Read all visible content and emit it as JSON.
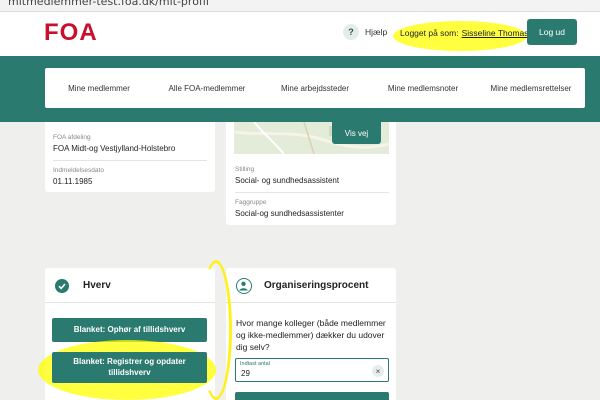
{
  "browser": {
    "url_fragment": "mitmedlemmer-test.foa.dk/mit-profil"
  },
  "header": {
    "logo_text": "FOA",
    "help_label": "Hjælp",
    "logged_in_prefix": "Logget på som:",
    "logged_in_user": "Sisseline Thomassen",
    "logout_label": "Log ud"
  },
  "nav": {
    "items": [
      "Mine medlemmer",
      "Alle FOA-medlemmer",
      "Mine arbejdssteder",
      "Mine medlemsnoter",
      "Mine medlemsrettelser"
    ]
  },
  "member_info": {
    "department_label": "FOA afdeling",
    "department_value": "FOA Midt-og Vestjylland-Holstebro",
    "enrollment_label": "Indmeldelsesdato",
    "enrollment_value": "01.11.1985"
  },
  "workplace": {
    "map_button": "Vis vej",
    "position_label": "Stilling",
    "position_value": "Social- og sundhedsassistent",
    "professional_group_label": "Faggruppe",
    "professional_group_value": "Social-og sundhedsassistenter"
  },
  "hverv": {
    "title": "Hverv",
    "button_resign": "Blanket: Ophør af tillidshverv",
    "button_register": "Blanket: Registrer og opdater tillidshverv"
  },
  "organisation": {
    "title": "Organiseringsprocent",
    "question": "Hvor mange kolleger (både medlemmer og ikke-medlemmer) dækker du udover dig selv?",
    "input_label": "Indtast antal",
    "input_value": "29"
  },
  "colors": {
    "brand_red": "#c8102e",
    "brand_teal": "#2b7a6f",
    "highlight": "#ffff00"
  }
}
